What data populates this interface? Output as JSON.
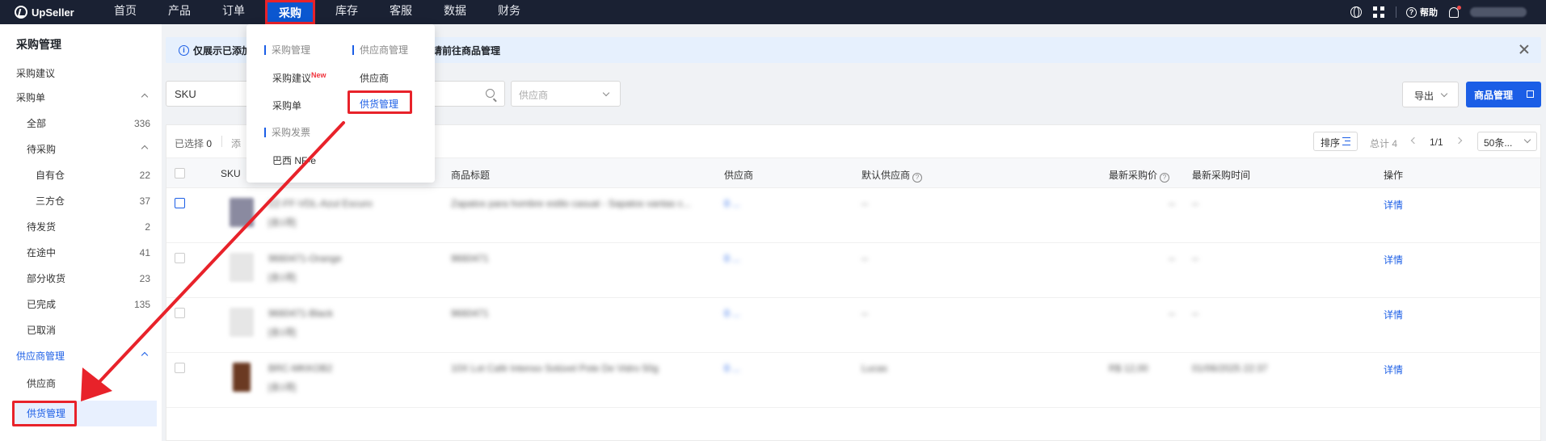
{
  "app": {
    "logo": "UpSeller"
  },
  "nav": {
    "items": [
      "首页",
      "产品",
      "订单",
      "采购",
      "库存",
      "客服",
      "数据",
      "财务"
    ],
    "active": "采购",
    "help_label": "帮助"
  },
  "sidebar": {
    "title": "采购管理",
    "items": [
      {
        "label": "采购建议",
        "count": ""
      },
      {
        "label": "采购单",
        "count": ""
      },
      {
        "label": "全部",
        "count": "336"
      },
      {
        "label": "待采购",
        "count": ""
      },
      {
        "label": "自有仓",
        "count": "22"
      },
      {
        "label": "三方仓",
        "count": "37"
      },
      {
        "label": "待发货",
        "count": "2"
      },
      {
        "label": "在途中",
        "count": "41"
      },
      {
        "label": "部分收货",
        "count": "23"
      },
      {
        "label": "已完成",
        "count": "135"
      },
      {
        "label": "已取消",
        "count": ""
      },
      {
        "label": "供应商管理",
        "count": ""
      },
      {
        "label": "供应商",
        "count": ""
      },
      {
        "label": "供货管理",
        "count": ""
      }
    ]
  },
  "notice": {
    "prefix": "仅展示已添加",
    "suffix": "应商，请前往商品管理"
  },
  "filter": {
    "sku_label": "SKU",
    "supplier_placeholder": "供应商"
  },
  "actions": {
    "export_label": "导出",
    "product_mgmt_label": "商品管理"
  },
  "toolbar": {
    "selected_label": "已选择",
    "selected_count": "0",
    "add_label": "添",
    "sort_label": "排序",
    "total_label": "总计 4",
    "page": "1/1",
    "per_page": "50条..."
  },
  "table": {
    "columns": [
      "SKU",
      "商品标题",
      "供应商",
      "默认供应商",
      "最新采购价",
      "最新采购时间",
      "操作"
    ],
    "rows": [
      {
        "sku": "ZZ-FF-VDL-Azul Escuro",
        "sub": "[含1项]",
        "title": "Zapatos para hombre estilo casual - Sapatos vantas c...",
        "supplier": "0 ...",
        "default_supplier": "--",
        "price": "--",
        "time": "--",
        "action": "详情"
      },
      {
        "sku": "9660471-Orange",
        "sub": "[含1项]",
        "title": "9660471",
        "supplier": "0 ...",
        "default_supplier": "--",
        "price": "--",
        "time": "--",
        "action": "详情"
      },
      {
        "sku": "9660471-Black",
        "sub": "[含1项]",
        "title": "9660471",
        "supplier": "0 ...",
        "default_supplier": "--",
        "price": "--",
        "time": "--",
        "action": "详情"
      },
      {
        "sku": "BRC-MKKOB2",
        "sub": "[含1项]",
        "title": "10X Lot Café Intenso Solúvel Pote De Vidro 50g",
        "supplier": "0 ...",
        "default_supplier": "Lucas",
        "price": "R$ 12,00",
        "time": "01/06/2025 22:37",
        "action": "详情"
      }
    ]
  },
  "dropdown": {
    "col1_head": "采购管理",
    "col1_items": [
      "采购建议",
      "采购单"
    ],
    "new_badge": "New",
    "col2_head": "供应商管理",
    "col2_items": [
      "供应商",
      "供货管理"
    ],
    "col3_head": "采购发票",
    "col3_items": [
      "巴西 NF-e"
    ]
  },
  "colors": {
    "accent": "#1b5ee6",
    "highlight": "#e8222a",
    "nav_bg": "#1a2133"
  }
}
